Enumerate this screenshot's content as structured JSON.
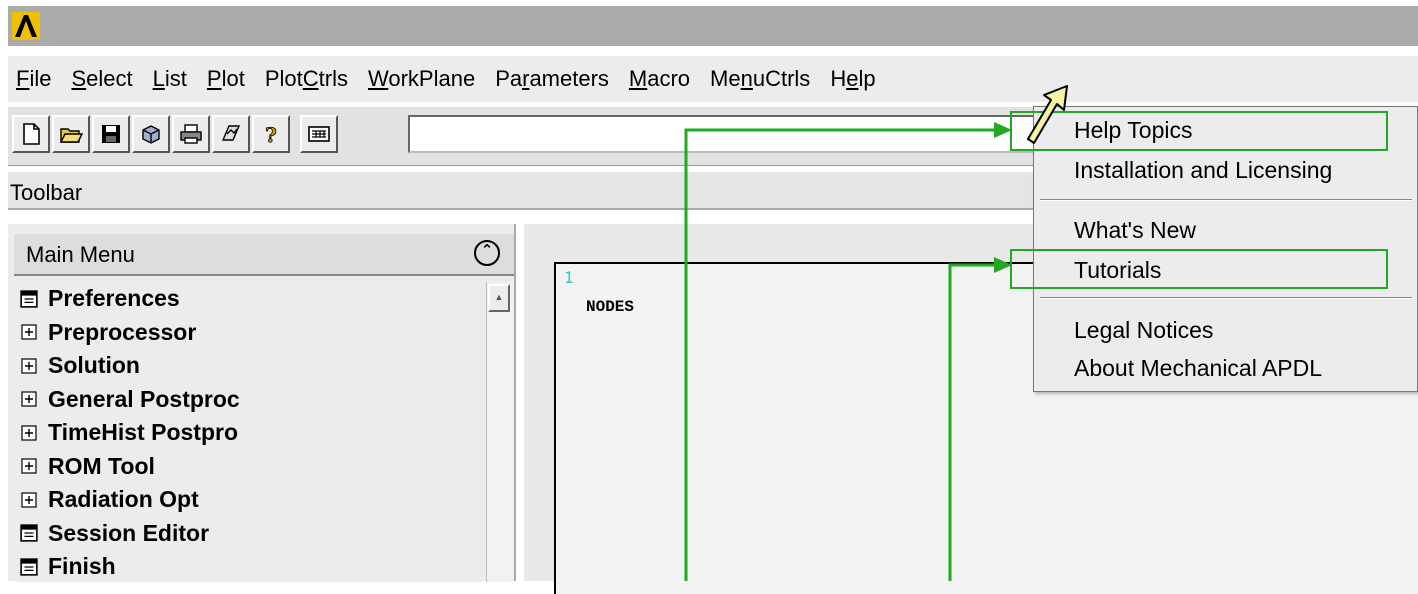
{
  "window": {
    "logo_glyph": "Λ",
    "logo_icon": "ansys-logo-icon"
  },
  "menubar": {
    "items": [
      {
        "pre": "",
        "u": "F",
        "post": "ile"
      },
      {
        "pre": "",
        "u": "S",
        "post": "elect"
      },
      {
        "pre": "",
        "u": "L",
        "post": "ist"
      },
      {
        "pre": "",
        "u": "P",
        "post": "lot"
      },
      {
        "pre": "Plot",
        "u": "C",
        "post": "trls"
      },
      {
        "pre": "",
        "u": "W",
        "post": "orkPlane"
      },
      {
        "pre": "Pa",
        "u": "r",
        "post": "ameters"
      },
      {
        "pre": "",
        "u": "M",
        "post": "acro"
      },
      {
        "pre": "Me",
        "u": "n",
        "post": "uCtrls"
      },
      {
        "pre": "H",
        "u": "e",
        "post": "lp"
      }
    ]
  },
  "toolbar": {
    "icons": [
      "new-file-icon",
      "open-folder-icon",
      "save-icon",
      "3d-box-icon",
      "print-icon",
      "report-icon",
      "help-question-icon",
      "keyboard-icon"
    ],
    "command_value": "",
    "label": "Toolbar"
  },
  "main_menu": {
    "title": "Main Menu",
    "collapse_glyph": "⌃",
    "items": [
      {
        "label": "Preferences",
        "icon": "dialog-icon"
      },
      {
        "label": "Preprocessor",
        "icon": "expand-icon"
      },
      {
        "label": "Solution",
        "icon": "expand-icon"
      },
      {
        "label": "General Postproc",
        "icon": "expand-icon"
      },
      {
        "label": "TimeHist Postpro",
        "icon": "expand-icon"
      },
      {
        "label": "ROM Tool",
        "icon": "expand-icon"
      },
      {
        "label": "Radiation Opt",
        "icon": "expand-icon"
      },
      {
        "label": "Session Editor",
        "icon": "dialog-icon"
      },
      {
        "label": "Finish",
        "icon": "dialog-icon"
      }
    ]
  },
  "graphics": {
    "window_number": "1",
    "label": "NODES"
  },
  "help_menu": {
    "items": [
      {
        "label": "Help Topics",
        "highlighted": true
      },
      {
        "label": "Installation and Licensing",
        "highlighted": false
      },
      {
        "label": "What's New",
        "highlighted": false
      },
      {
        "label": "Tutorials",
        "highlighted": true
      },
      {
        "label": "Legal Notices",
        "highlighted": false
      },
      {
        "label": "About Mechanical APDL",
        "highlighted": false
      }
    ]
  },
  "colors": {
    "annotation_green": "#22a822",
    "cursor_fill": "#f7f3a0",
    "window_number": "#3ec0c0"
  }
}
